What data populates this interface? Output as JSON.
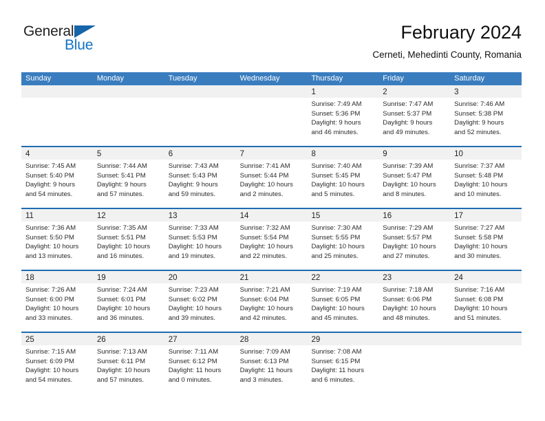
{
  "logo": {
    "word_top": "General",
    "word_bottom": "Blue",
    "triangle_color": "#1565a8",
    "blue_color": "#1273c4"
  },
  "header": {
    "title": "February 2024",
    "subtitle": "Cerneti, Mehedinti County, Romania"
  },
  "theme": {
    "header_bg": "#3a7dbf",
    "week_separator": "#1f6cb0",
    "day_band_bg": "#f1f1f1"
  },
  "weekdays": [
    "Sunday",
    "Monday",
    "Tuesday",
    "Wednesday",
    "Thursday",
    "Friday",
    "Saturday"
  ],
  "weeks": [
    [
      {
        "day": "",
        "sunrise": "",
        "sunset": "",
        "daylight_1": "",
        "daylight_2": ""
      },
      {
        "day": "",
        "sunrise": "",
        "sunset": "",
        "daylight_1": "",
        "daylight_2": ""
      },
      {
        "day": "",
        "sunrise": "",
        "sunset": "",
        "daylight_1": "",
        "daylight_2": ""
      },
      {
        "day": "",
        "sunrise": "",
        "sunset": "",
        "daylight_1": "",
        "daylight_2": ""
      },
      {
        "day": "1",
        "sunrise": "Sunrise: 7:49 AM",
        "sunset": "Sunset: 5:36 PM",
        "daylight_1": "Daylight: 9 hours",
        "daylight_2": "and 46 minutes."
      },
      {
        "day": "2",
        "sunrise": "Sunrise: 7:47 AM",
        "sunset": "Sunset: 5:37 PM",
        "daylight_1": "Daylight: 9 hours",
        "daylight_2": "and 49 minutes."
      },
      {
        "day": "3",
        "sunrise": "Sunrise: 7:46 AM",
        "sunset": "Sunset: 5:38 PM",
        "daylight_1": "Daylight: 9 hours",
        "daylight_2": "and 52 minutes."
      }
    ],
    [
      {
        "day": "4",
        "sunrise": "Sunrise: 7:45 AM",
        "sunset": "Sunset: 5:40 PM",
        "daylight_1": "Daylight: 9 hours",
        "daylight_2": "and 54 minutes."
      },
      {
        "day": "5",
        "sunrise": "Sunrise: 7:44 AM",
        "sunset": "Sunset: 5:41 PM",
        "daylight_1": "Daylight: 9 hours",
        "daylight_2": "and 57 minutes."
      },
      {
        "day": "6",
        "sunrise": "Sunrise: 7:43 AM",
        "sunset": "Sunset: 5:43 PM",
        "daylight_1": "Daylight: 9 hours",
        "daylight_2": "and 59 minutes."
      },
      {
        "day": "7",
        "sunrise": "Sunrise: 7:41 AM",
        "sunset": "Sunset: 5:44 PM",
        "daylight_1": "Daylight: 10 hours",
        "daylight_2": "and 2 minutes."
      },
      {
        "day": "8",
        "sunrise": "Sunrise: 7:40 AM",
        "sunset": "Sunset: 5:45 PM",
        "daylight_1": "Daylight: 10 hours",
        "daylight_2": "and 5 minutes."
      },
      {
        "day": "9",
        "sunrise": "Sunrise: 7:39 AM",
        "sunset": "Sunset: 5:47 PM",
        "daylight_1": "Daylight: 10 hours",
        "daylight_2": "and 8 minutes."
      },
      {
        "day": "10",
        "sunrise": "Sunrise: 7:37 AM",
        "sunset": "Sunset: 5:48 PM",
        "daylight_1": "Daylight: 10 hours",
        "daylight_2": "and 10 minutes."
      }
    ],
    [
      {
        "day": "11",
        "sunrise": "Sunrise: 7:36 AM",
        "sunset": "Sunset: 5:50 PM",
        "daylight_1": "Daylight: 10 hours",
        "daylight_2": "and 13 minutes."
      },
      {
        "day": "12",
        "sunrise": "Sunrise: 7:35 AM",
        "sunset": "Sunset: 5:51 PM",
        "daylight_1": "Daylight: 10 hours",
        "daylight_2": "and 16 minutes."
      },
      {
        "day": "13",
        "sunrise": "Sunrise: 7:33 AM",
        "sunset": "Sunset: 5:53 PM",
        "daylight_1": "Daylight: 10 hours",
        "daylight_2": "and 19 minutes."
      },
      {
        "day": "14",
        "sunrise": "Sunrise: 7:32 AM",
        "sunset": "Sunset: 5:54 PM",
        "daylight_1": "Daylight: 10 hours",
        "daylight_2": "and 22 minutes."
      },
      {
        "day": "15",
        "sunrise": "Sunrise: 7:30 AM",
        "sunset": "Sunset: 5:55 PM",
        "daylight_1": "Daylight: 10 hours",
        "daylight_2": "and 25 minutes."
      },
      {
        "day": "16",
        "sunrise": "Sunrise: 7:29 AM",
        "sunset": "Sunset: 5:57 PM",
        "daylight_1": "Daylight: 10 hours",
        "daylight_2": "and 27 minutes."
      },
      {
        "day": "17",
        "sunrise": "Sunrise: 7:27 AM",
        "sunset": "Sunset: 5:58 PM",
        "daylight_1": "Daylight: 10 hours",
        "daylight_2": "and 30 minutes."
      }
    ],
    [
      {
        "day": "18",
        "sunrise": "Sunrise: 7:26 AM",
        "sunset": "Sunset: 6:00 PM",
        "daylight_1": "Daylight: 10 hours",
        "daylight_2": "and 33 minutes."
      },
      {
        "day": "19",
        "sunrise": "Sunrise: 7:24 AM",
        "sunset": "Sunset: 6:01 PM",
        "daylight_1": "Daylight: 10 hours",
        "daylight_2": "and 36 minutes."
      },
      {
        "day": "20",
        "sunrise": "Sunrise: 7:23 AM",
        "sunset": "Sunset: 6:02 PM",
        "daylight_1": "Daylight: 10 hours",
        "daylight_2": "and 39 minutes."
      },
      {
        "day": "21",
        "sunrise": "Sunrise: 7:21 AM",
        "sunset": "Sunset: 6:04 PM",
        "daylight_1": "Daylight: 10 hours",
        "daylight_2": "and 42 minutes."
      },
      {
        "day": "22",
        "sunrise": "Sunrise: 7:19 AM",
        "sunset": "Sunset: 6:05 PM",
        "daylight_1": "Daylight: 10 hours",
        "daylight_2": "and 45 minutes."
      },
      {
        "day": "23",
        "sunrise": "Sunrise: 7:18 AM",
        "sunset": "Sunset: 6:06 PM",
        "daylight_1": "Daylight: 10 hours",
        "daylight_2": "and 48 minutes."
      },
      {
        "day": "24",
        "sunrise": "Sunrise: 7:16 AM",
        "sunset": "Sunset: 6:08 PM",
        "daylight_1": "Daylight: 10 hours",
        "daylight_2": "and 51 minutes."
      }
    ],
    [
      {
        "day": "25",
        "sunrise": "Sunrise: 7:15 AM",
        "sunset": "Sunset: 6:09 PM",
        "daylight_1": "Daylight: 10 hours",
        "daylight_2": "and 54 minutes."
      },
      {
        "day": "26",
        "sunrise": "Sunrise: 7:13 AM",
        "sunset": "Sunset: 6:11 PM",
        "daylight_1": "Daylight: 10 hours",
        "daylight_2": "and 57 minutes."
      },
      {
        "day": "27",
        "sunrise": "Sunrise: 7:11 AM",
        "sunset": "Sunset: 6:12 PM",
        "daylight_1": "Daylight: 11 hours",
        "daylight_2": "and 0 minutes."
      },
      {
        "day": "28",
        "sunrise": "Sunrise: 7:09 AM",
        "sunset": "Sunset: 6:13 PM",
        "daylight_1": "Daylight: 11 hours",
        "daylight_2": "and 3 minutes."
      },
      {
        "day": "29",
        "sunrise": "Sunrise: 7:08 AM",
        "sunset": "Sunset: 6:15 PM",
        "daylight_1": "Daylight: 11 hours",
        "daylight_2": "and 6 minutes."
      },
      {
        "day": "",
        "sunrise": "",
        "sunset": "",
        "daylight_1": "",
        "daylight_2": ""
      },
      {
        "day": "",
        "sunrise": "",
        "sunset": "",
        "daylight_1": "",
        "daylight_2": ""
      }
    ]
  ]
}
